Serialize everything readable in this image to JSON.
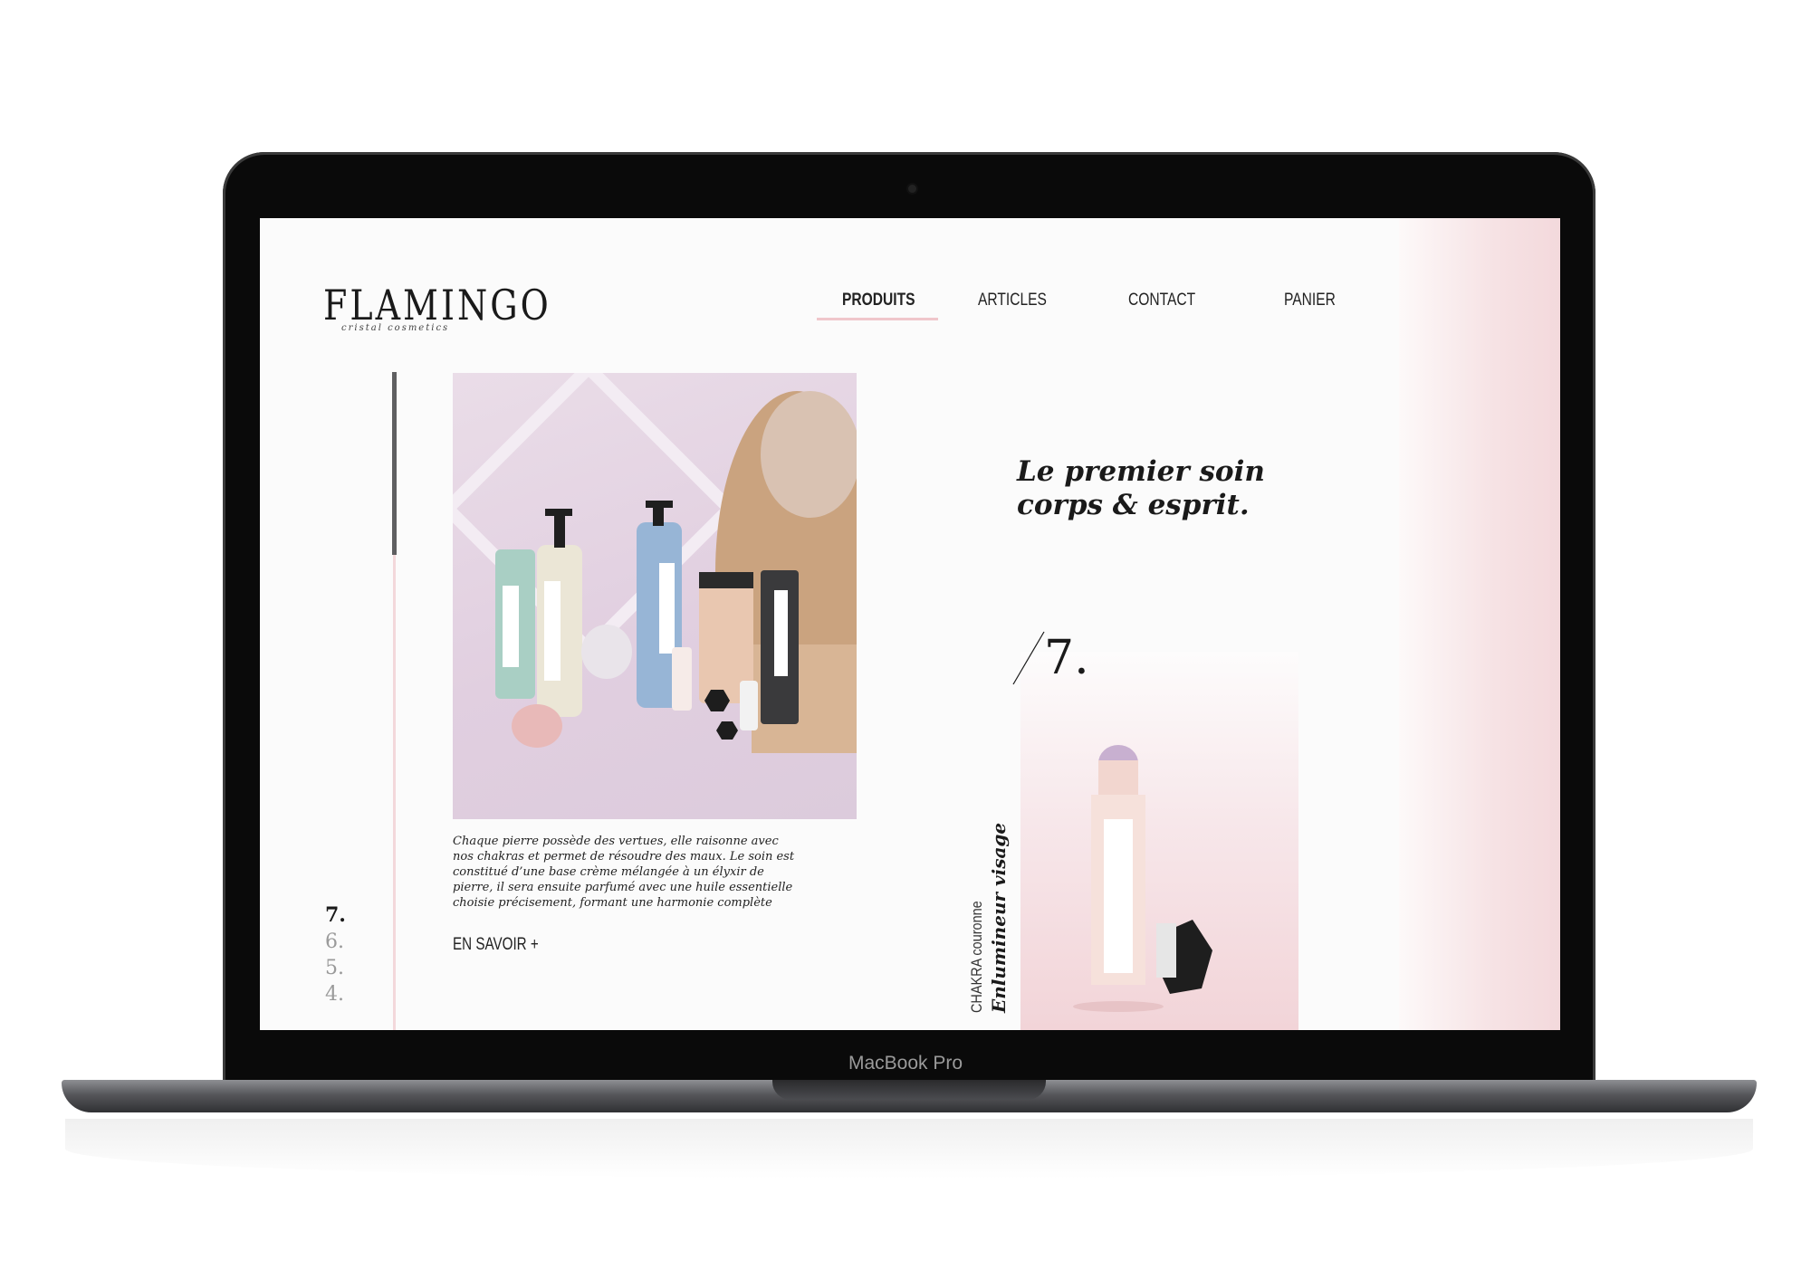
{
  "device": {
    "bezel_label": "MacBook Pro"
  },
  "site": {
    "logo": "FLAMINGO",
    "logo_subtitle": "cristal cosmetics",
    "nav": [
      {
        "label": "PRODUITS",
        "active": true
      },
      {
        "label": "ARTICLES",
        "active": false
      },
      {
        "label": "CONTACT",
        "active": false
      },
      {
        "label": "PANIER",
        "active": false
      }
    ],
    "hero": {
      "caption": "Chaque pierre possède des vertues, elle raisonne avec nos chakras et permet de résoudre des maux. Le soin est constitué d’une base crème mélangée à un élyxir de pierre, il sera ensuite parfumé avec une huile essentielle choisie précisement, formant une harmonie complète",
      "more_label": "EN SAVOIR +"
    },
    "pager": [
      "7.",
      "6.",
      "5.",
      "4."
    ],
    "tagline": {
      "line1": "Le premier soin",
      "line2": "corps & esprit."
    },
    "feature": {
      "number": "7.",
      "collection": "CHAKRA couronne",
      "product": "Enlumineur visage"
    },
    "colors": {
      "accent_pink": "#f0c6cb",
      "text_dark": "#1a1a1a",
      "muted": "#9a9a9a"
    }
  }
}
